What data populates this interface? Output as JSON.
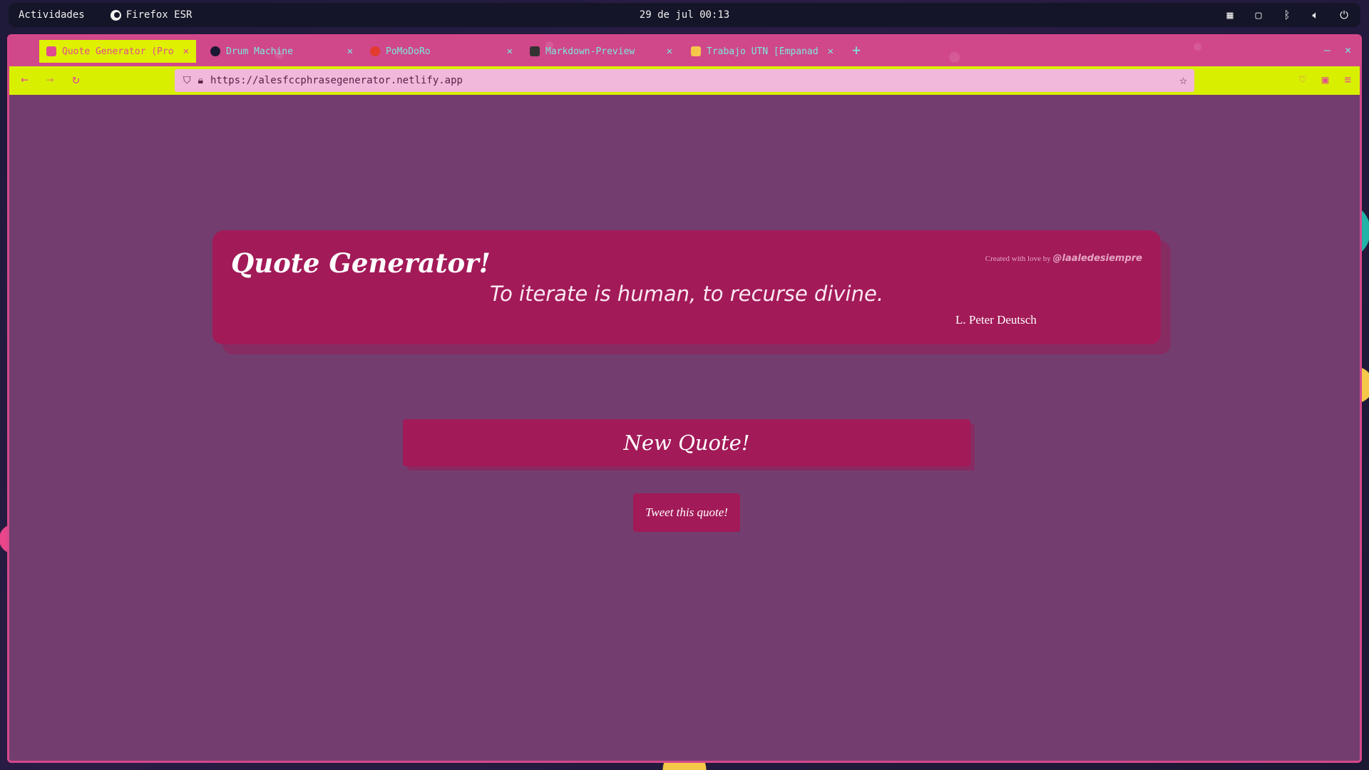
{
  "topbar": {
    "activities": "Actividades",
    "app_name": "Firefox ESR",
    "clock": "29 de jul 00:13"
  },
  "tabs": [
    {
      "label": "Quote Generator (Pro",
      "active": true,
      "icon": "quote-favicon",
      "color": "#e04b90"
    },
    {
      "label": "Drum Machine",
      "active": false,
      "icon": "drum-favicon",
      "color": "#1b1834"
    },
    {
      "label": "PoMoDoRo",
      "active": false,
      "icon": "tomato-favicon",
      "color": "#e33b2e"
    },
    {
      "label": "Markdown-Preview",
      "active": false,
      "icon": "markdown-favicon",
      "color": "#333333"
    },
    {
      "label": "Trabajo UTN [Empanad",
      "active": false,
      "icon": "empanada-favicon",
      "color": "#f5c84a"
    }
  ],
  "navbar": {
    "url": "https://alesfccphrasegenerator.netlify.app"
  },
  "page": {
    "title": "Quote Generator!",
    "credit_prefix": "Created with love by",
    "credit_handle": "@laaledesiempre",
    "quote_text": "To iterate is human, to recurse divine.",
    "quote_author": "L. Peter Deutsch",
    "new_quote_label": "New Quote!",
    "tweet_label": "Tweet this quote!"
  },
  "colors": {
    "page_bg": "#733e6f",
    "card_bg": "#a21a58",
    "tabbar_bg": "#d0478a",
    "navbar_bg": "#d8f000",
    "active_tab_bg": "#dff000"
  }
}
